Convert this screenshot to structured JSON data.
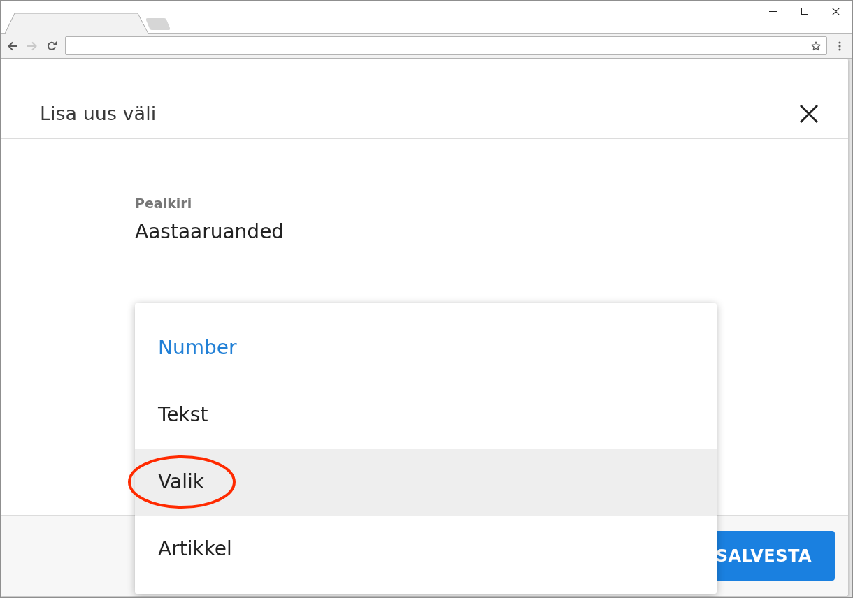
{
  "browser": {
    "nav_buttons": [
      {
        "kind": "back",
        "disabled": false
      },
      {
        "kind": "forward",
        "disabled": true
      },
      {
        "kind": "reload",
        "disabled": false
      }
    ]
  },
  "dialog": {
    "title": "Lisa uus väli",
    "fields": [
      {
        "label": "Pealkiri",
        "value": "Aastaaruanded"
      }
    ],
    "type_menu": {
      "options": [
        {
          "label": "Number",
          "selected": true,
          "highlighted": false,
          "circled": false
        },
        {
          "label": "Tekst",
          "selected": false,
          "highlighted": false,
          "circled": false
        },
        {
          "label": "Valik",
          "selected": false,
          "highlighted": true,
          "circled": true
        },
        {
          "label": "Artikkel",
          "selected": false,
          "highlighted": false,
          "circled": false
        }
      ]
    },
    "buttons": [
      {
        "label": "SALVESTA",
        "kind": "primary"
      }
    ]
  }
}
